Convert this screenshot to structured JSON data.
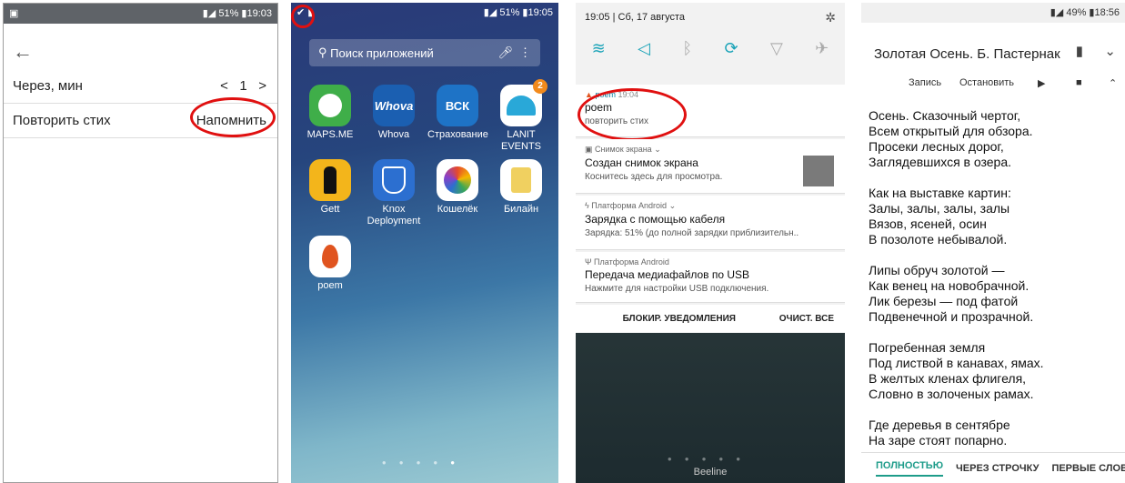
{
  "phone1": {
    "status_time": "19:03",
    "status_battery": "51%",
    "row1_label": "Через, мин",
    "stepper_prev": "<",
    "stepper_value": "1",
    "stepper_next": ">",
    "row2_label": "Повторить стих",
    "remind_label": "Напомнить"
  },
  "phone2": {
    "status_time": "19:05",
    "status_battery": "51%",
    "search_placeholder": "Поиск приложений",
    "apps": [
      {
        "label": "MAPS.ME",
        "icon_text": "",
        "color": "#3fae49"
      },
      {
        "label": "Whova",
        "icon_text": "Whova",
        "color": "#1b5fb1"
      },
      {
        "label": "Страхование",
        "icon_text": "ВСК",
        "color": "#1e73c6"
      },
      {
        "label": "LANIT EVENTS",
        "icon_text": "",
        "color": "#29a8d8",
        "badge": "2"
      },
      {
        "label": "Gett",
        "icon_text": "",
        "color": "#f3b51b"
      },
      {
        "label": "Knox Deployment",
        "icon_text": "",
        "color": "#2c6fd0"
      },
      {
        "label": "Кошелёк",
        "icon_text": "",
        "color": "#222244"
      },
      {
        "label": "Билайн",
        "icon_text": "",
        "color": "#f0d060"
      },
      {
        "label": "poem",
        "icon_text": "",
        "color": "#ffffff"
      }
    ]
  },
  "phone3": {
    "status_date": "19:05 | Сб, 17 августа",
    "notifications": [
      {
        "app": "poem",
        "time": "19:04",
        "title": "poem",
        "text": "повторить стих"
      },
      {
        "app": "Снимок экрана",
        "time": "",
        "title": "Создан снимок экрана",
        "text": "Коснитесь здесь для просмотра."
      },
      {
        "app": "Платформа Android",
        "time": "",
        "title": "Зарядка с помощью кабеля",
        "text": "Зарядка: 51% (до полной зарядки приблизительн.."
      },
      {
        "app": "Платформа Android",
        "time": "",
        "title": "Передача медиафайлов по USB",
        "text": "Нажмите для настройки USB подключения."
      }
    ],
    "block_label": "БЛОКИР. УВЕДОМЛЕНИЯ",
    "clear_label": "ОЧИСТ. ВСЕ",
    "carrier": "Beeline"
  },
  "phone4": {
    "status_time": "18:56",
    "status_battery": "49%",
    "title": "Золотая Осень. Б. Пастернак",
    "record_label": "Запись",
    "stop_label": "Остановить",
    "poem_text": "Осень. Сказочный чертог,\nВсем открытый для обзора.\nПросеки лесных дорог,\nЗаглядевшихся в озера.\n\nКак на выставке картин:\nЗалы, залы, залы, залы\nВязов, ясеней, осин\nВ позолоте небывалой.\n\nЛипы обруч золотой —\nКак венец на новобрачной.\nЛик березы — под фатой\nПодвенечной и прозрачной.\n\nПогребенная земля\nПод листвой в канавах, ямах.\nВ желтых кленах флигеля,\nСловно в золоченых рамах.\n\nГде деревья в сентябре\nНа заре стоят попарно.",
    "tab_full": "ПОЛНОСТЬЮ",
    "tab_every_line": "ЧЕРЕЗ СТРОЧКУ",
    "tab_first_words": "ПЕРВЫЕ СЛОВА",
    "accent": "#1e9c8a"
  }
}
